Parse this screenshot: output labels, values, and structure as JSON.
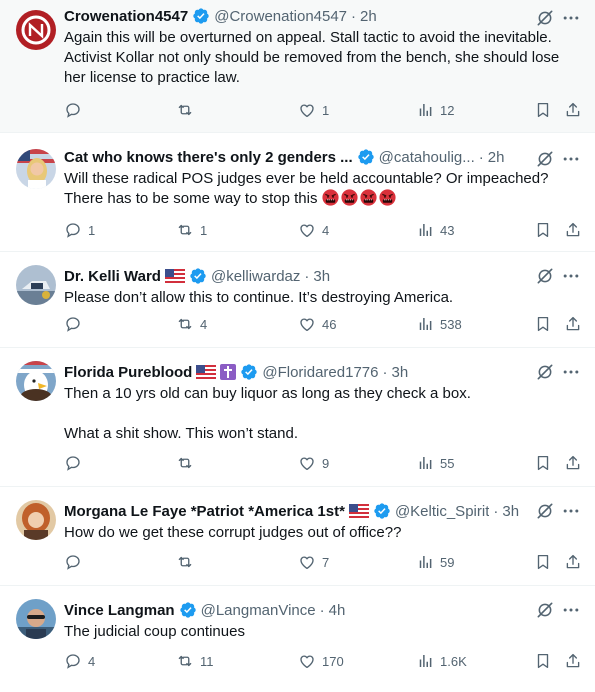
{
  "tweets": [
    {
      "name": "Crowenation4547",
      "handle": "@Crowenation4547",
      "sep": "·",
      "time": "2h",
      "text": "Again this will be overturned on appeal. Stall tactic to avoid the inevitable. Activist Kollar not only should be removed from the bench, she should lose her license to practice law.",
      "replies": "",
      "retweets": "",
      "likes": "1",
      "views": "12"
    },
    {
      "name": "Cat who knows there's only 2 genders ...",
      "handle": "@catahoulig...",
      "sep": "·",
      "time": "2h",
      "text": "Will these radical POS judges ever be held accountable? Or impeached? There has to be some way to stop this",
      "emojis": [
        "enraged-face-icon",
        "enraged-face-icon",
        "enraged-face-icon",
        "enraged-face-icon"
      ],
      "replies": "1",
      "retweets": "1",
      "likes": "4",
      "views": "43"
    },
    {
      "name": "Dr. Kelli Ward",
      "handle": "@kelliwardaz",
      "sep": "·",
      "time": "3h",
      "text": "Please don’t allow this to continue. It’s destroying America.",
      "replies": "",
      "retweets": "4",
      "likes": "46",
      "views": "538"
    },
    {
      "name": "Florida Pureblood",
      "handle": "@Floridared1776",
      "sep": "·",
      "time": "3h",
      "text": "Then a 10 yrs old can buy liquor as long as they check a box.\n\nWhat a shit show. This won’t stand.",
      "replies": "",
      "retweets": "",
      "likes": "9",
      "views": "55"
    },
    {
      "name": "Morgana Le Faye *Patriot *America 1st*",
      "handle": "@Keltic_Spirit",
      "sep": "·",
      "time": "3h",
      "text": "How do we get these corrupt judges out of office??",
      "replies": "",
      "retweets": "",
      "likes": "7",
      "views": "59"
    },
    {
      "name": "Vince Langman",
      "handle": "@LangmanVince",
      "sep": "·",
      "time": "4h",
      "text": "The judicial coup continues",
      "replies": "4",
      "retweets": "11",
      "likes": "170",
      "views": "1.6K"
    }
  ],
  "colors": {
    "text": "#0f1419",
    "secondary": "#536471",
    "verified": "#1d9bf0",
    "divider": "#eff3f4",
    "highlight_bg": "#f7f9f9"
  },
  "icons": [
    "verified-badge-icon",
    "grok-icon",
    "more-icon",
    "reply-icon",
    "retweet-icon",
    "like-icon",
    "views-icon",
    "bookmark-icon",
    "share-icon",
    "us-flag-icon",
    "cross-icon"
  ]
}
